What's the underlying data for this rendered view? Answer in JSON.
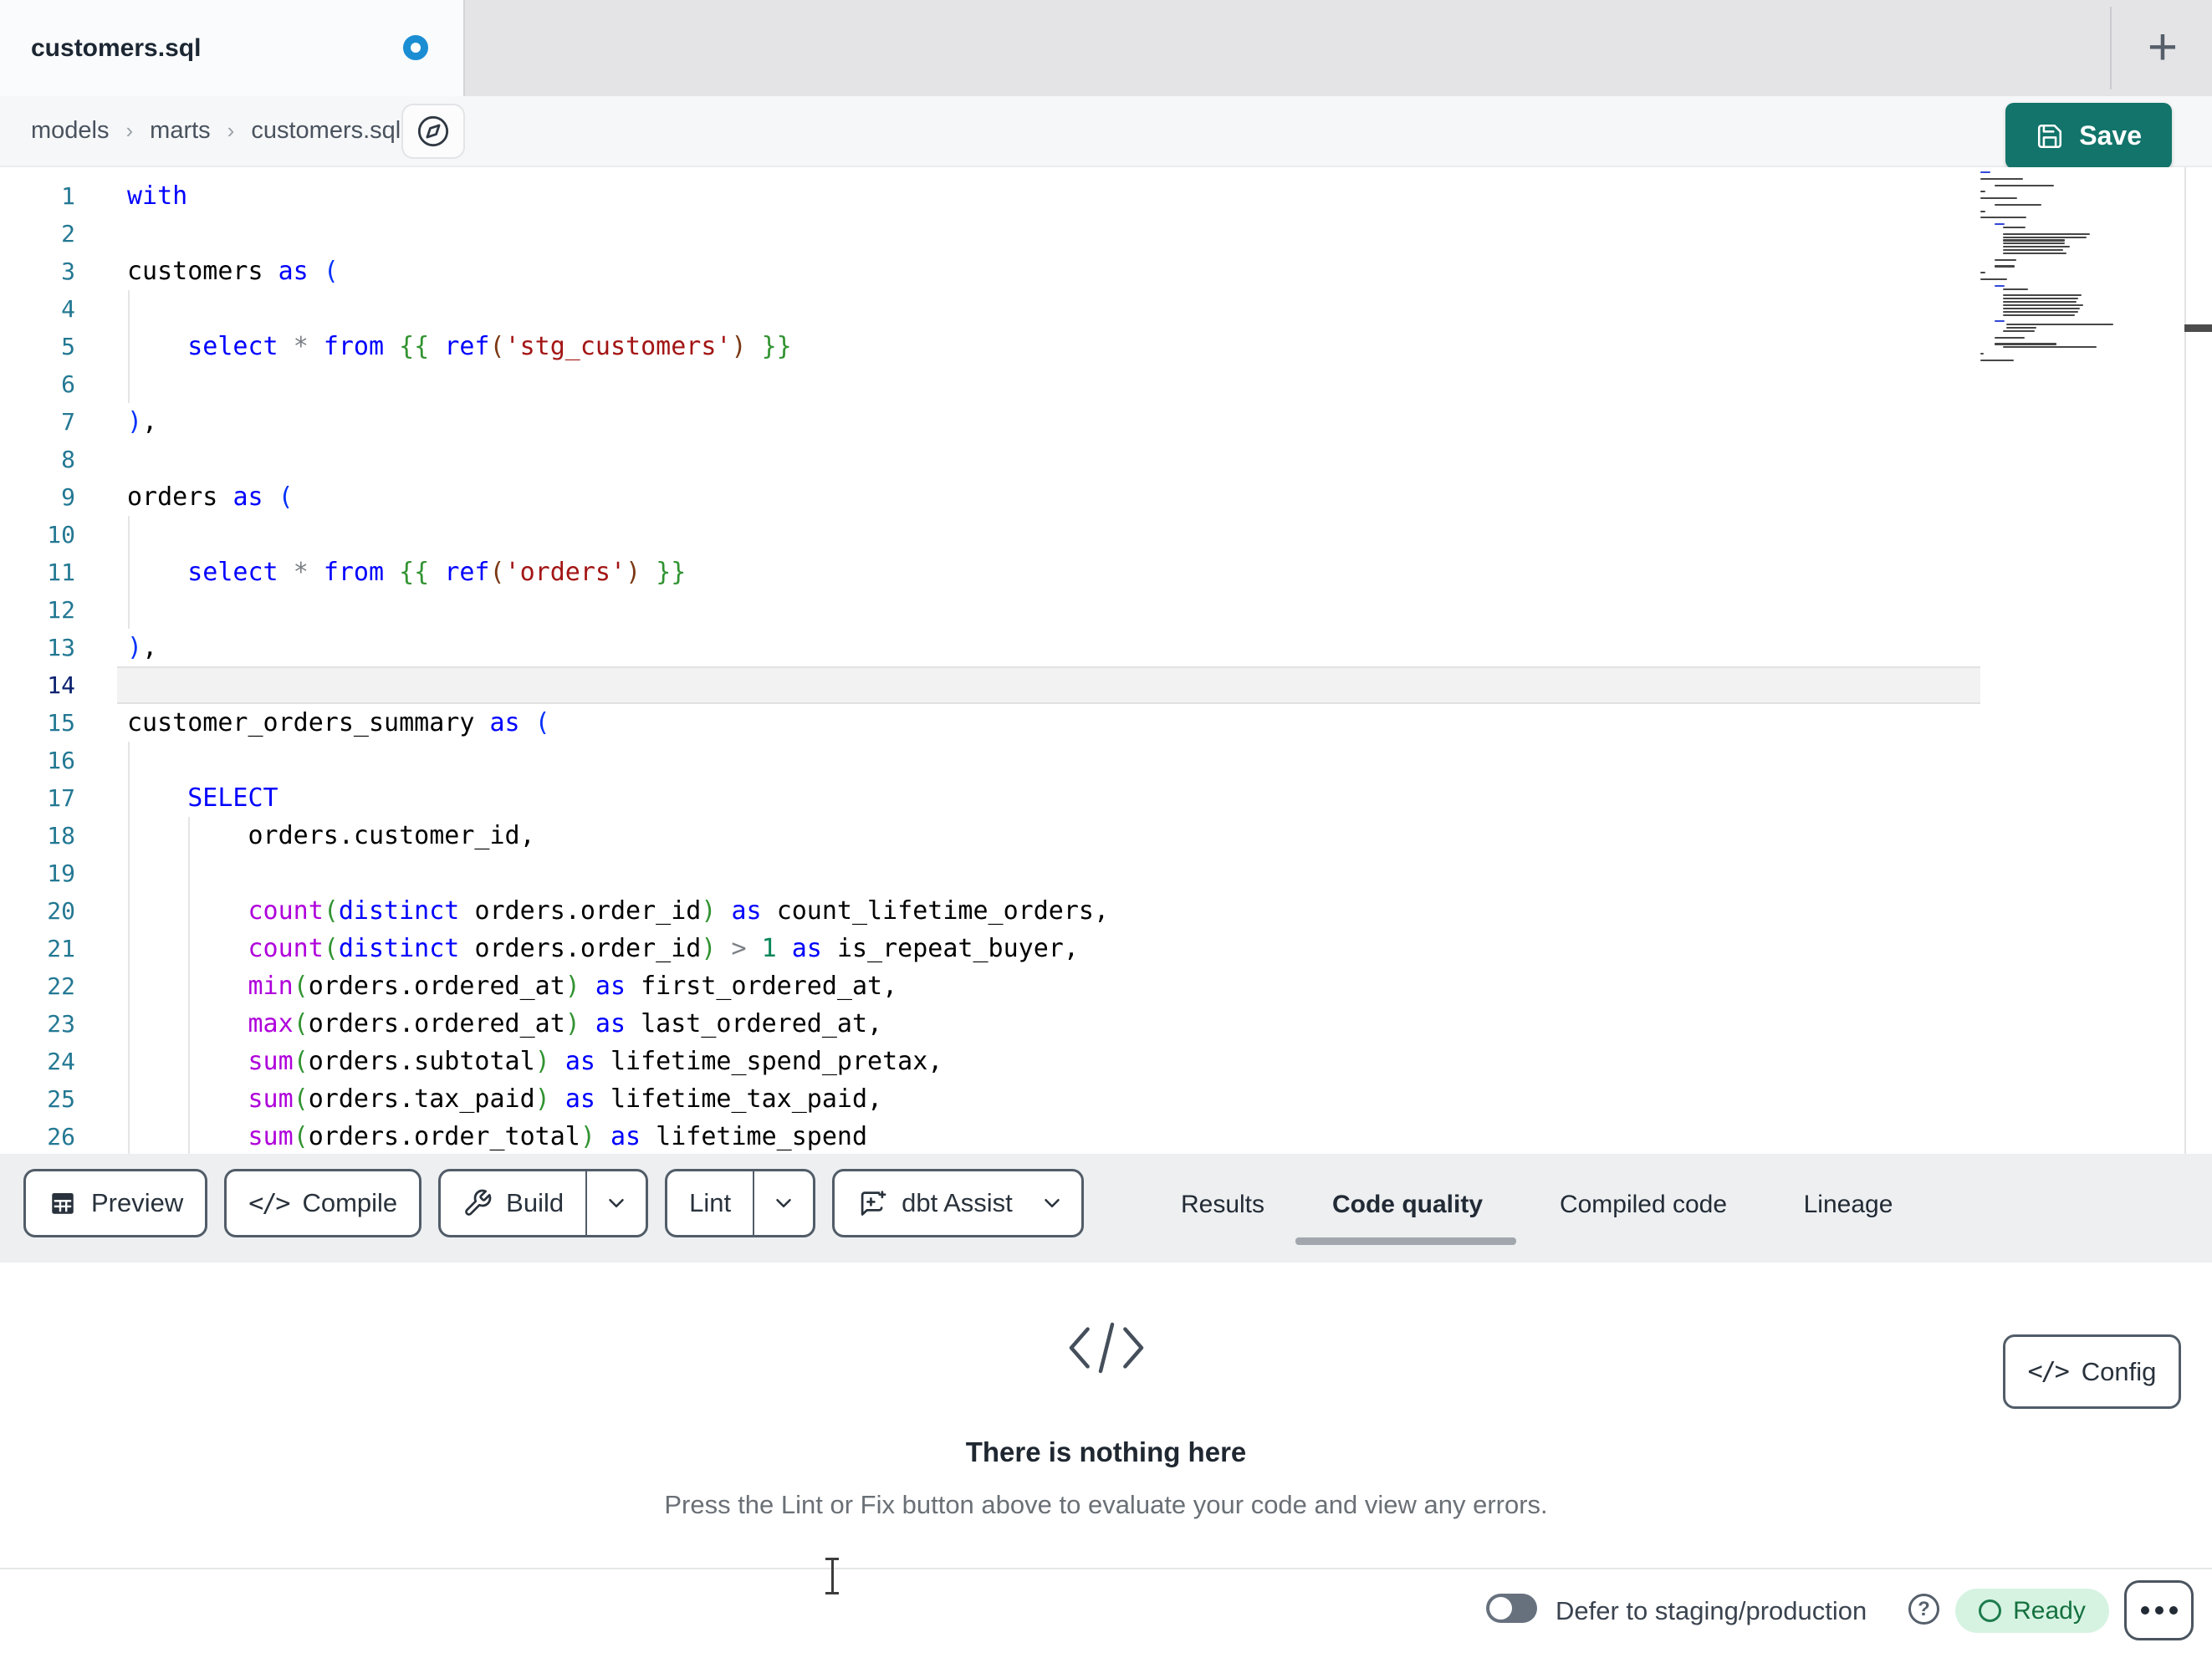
{
  "tab_bar": {
    "active_tab": "customers.sql",
    "unsaved_indicator": true,
    "new_tab_label": "+"
  },
  "breadcrumb": {
    "items": [
      "models",
      "marts",
      "customers.sql"
    ],
    "separator": "›"
  },
  "actions": {
    "save_label": "Save"
  },
  "editor": {
    "current_line": 14,
    "lines": [
      {
        "n": 1,
        "t": [
          [
            "kw",
            "with"
          ]
        ]
      },
      {
        "n": 2,
        "t": []
      },
      {
        "n": 3,
        "t": [
          [
            "id",
            "customers "
          ],
          [
            "kw",
            "as"
          ],
          [
            "txt",
            " "
          ],
          [
            "b1",
            "("
          ]
        ]
      },
      {
        "n": 4,
        "t": []
      },
      {
        "n": 5,
        "t": [
          [
            "txt",
            "    "
          ],
          [
            "kw",
            "select"
          ],
          [
            "txt",
            " "
          ],
          [
            "op",
            "*"
          ],
          [
            "txt",
            " "
          ],
          [
            "kw",
            "from"
          ],
          [
            "txt",
            " "
          ],
          [
            "b2",
            "{{"
          ],
          [
            "txt",
            " "
          ],
          [
            "kw",
            "ref"
          ],
          [
            "b3",
            "("
          ],
          [
            "str",
            "'stg_customers'"
          ],
          [
            "b3",
            ")"
          ],
          [
            "txt",
            " "
          ],
          [
            "b2",
            "}}"
          ]
        ]
      },
      {
        "n": 6,
        "t": []
      },
      {
        "n": 7,
        "t": [
          [
            "b1",
            ")"
          ],
          [
            "id",
            ","
          ]
        ]
      },
      {
        "n": 8,
        "t": []
      },
      {
        "n": 9,
        "t": [
          [
            "id",
            "orders "
          ],
          [
            "kw",
            "as"
          ],
          [
            "txt",
            " "
          ],
          [
            "b1",
            "("
          ]
        ]
      },
      {
        "n": 10,
        "t": []
      },
      {
        "n": 11,
        "t": [
          [
            "txt",
            "    "
          ],
          [
            "kw",
            "select"
          ],
          [
            "txt",
            " "
          ],
          [
            "op",
            "*"
          ],
          [
            "txt",
            " "
          ],
          [
            "kw",
            "from"
          ],
          [
            "txt",
            " "
          ],
          [
            "b2",
            "{{"
          ],
          [
            "txt",
            " "
          ],
          [
            "kw",
            "ref"
          ],
          [
            "b3",
            "("
          ],
          [
            "str",
            "'orders'"
          ],
          [
            "b3",
            ")"
          ],
          [
            "txt",
            " "
          ],
          [
            "b2",
            "}}"
          ]
        ]
      },
      {
        "n": 12,
        "t": []
      },
      {
        "n": 13,
        "t": [
          [
            "b1",
            ")"
          ],
          [
            "id",
            ","
          ]
        ]
      },
      {
        "n": 14,
        "t": []
      },
      {
        "n": 15,
        "t": [
          [
            "id",
            "customer_orders_summary "
          ],
          [
            "kw",
            "as"
          ],
          [
            "txt",
            " "
          ],
          [
            "b1",
            "("
          ]
        ]
      },
      {
        "n": 16,
        "t": []
      },
      {
        "n": 17,
        "t": [
          [
            "txt",
            "    "
          ],
          [
            "kw",
            "SELECT"
          ]
        ]
      },
      {
        "n": 18,
        "t": [
          [
            "txt",
            "        "
          ],
          [
            "id",
            "orders.customer_id,"
          ]
        ]
      },
      {
        "n": 19,
        "t": []
      },
      {
        "n": 20,
        "t": [
          [
            "txt",
            "        "
          ],
          [
            "fn",
            "count"
          ],
          [
            "b2",
            "("
          ],
          [
            "kw",
            "distinct"
          ],
          [
            "txt",
            " "
          ],
          [
            "id",
            "orders.order_id"
          ],
          [
            "b2",
            ")"
          ],
          [
            "txt",
            " "
          ],
          [
            "kw",
            "as"
          ],
          [
            "txt",
            " "
          ],
          [
            "id",
            "count_lifetime_orders,"
          ]
        ]
      },
      {
        "n": 21,
        "t": [
          [
            "txt",
            "        "
          ],
          [
            "fn",
            "count"
          ],
          [
            "b2",
            "("
          ],
          [
            "kw",
            "distinct"
          ],
          [
            "txt",
            " "
          ],
          [
            "id",
            "orders.order_id"
          ],
          [
            "b2",
            ")"
          ],
          [
            "txt",
            " "
          ],
          [
            "op",
            ">"
          ],
          [
            "txt",
            " "
          ],
          [
            "num",
            "1"
          ],
          [
            "txt",
            " "
          ],
          [
            "kw",
            "as"
          ],
          [
            "txt",
            " "
          ],
          [
            "id",
            "is_repeat_buyer,"
          ]
        ]
      },
      {
        "n": 22,
        "t": [
          [
            "txt",
            "        "
          ],
          [
            "fn",
            "min"
          ],
          [
            "b2",
            "("
          ],
          [
            "id",
            "orders.ordered_at"
          ],
          [
            "b2",
            ")"
          ],
          [
            "txt",
            " "
          ],
          [
            "kw",
            "as"
          ],
          [
            "txt",
            " "
          ],
          [
            "id",
            "first_ordered_at,"
          ]
        ]
      },
      {
        "n": 23,
        "t": [
          [
            "txt",
            "        "
          ],
          [
            "fn",
            "max"
          ],
          [
            "b2",
            "("
          ],
          [
            "id",
            "orders.ordered_at"
          ],
          [
            "b2",
            ")"
          ],
          [
            "txt",
            " "
          ],
          [
            "kw",
            "as"
          ],
          [
            "txt",
            " "
          ],
          [
            "id",
            "last_ordered_at,"
          ]
        ]
      },
      {
        "n": 24,
        "t": [
          [
            "txt",
            "        "
          ],
          [
            "fn",
            "sum"
          ],
          [
            "b2",
            "("
          ],
          [
            "id",
            "orders.subtotal"
          ],
          [
            "b2",
            ")"
          ],
          [
            "txt",
            " "
          ],
          [
            "kw",
            "as"
          ],
          [
            "txt",
            " "
          ],
          [
            "id",
            "lifetime_spend_pretax,"
          ]
        ]
      },
      {
        "n": 25,
        "t": [
          [
            "txt",
            "        "
          ],
          [
            "fn",
            "sum"
          ],
          [
            "b2",
            "("
          ],
          [
            "id",
            "orders.tax_paid"
          ],
          [
            "b2",
            ")"
          ],
          [
            "txt",
            " "
          ],
          [
            "kw",
            "as"
          ],
          [
            "txt",
            " "
          ],
          [
            "id",
            "lifetime_tax_paid,"
          ]
        ]
      },
      {
        "n": 26,
        "t": [
          [
            "txt",
            "        "
          ],
          [
            "fn",
            "sum"
          ],
          [
            "b2",
            "("
          ],
          [
            "id",
            "orders.order_total"
          ],
          [
            "b2",
            ")"
          ],
          [
            "txt",
            " "
          ],
          [
            "kw",
            "as"
          ],
          [
            "txt",
            " "
          ],
          [
            "id",
            "lifetime_spend"
          ]
        ]
      }
    ]
  },
  "minimap": {
    "rows": [
      {
        "x": 0,
        "w": 12,
        "c": "#3148d8"
      },
      {
        "x": 0,
        "w": 0,
        "c": "transparent"
      },
      {
        "x": 0,
        "w": 51,
        "c": "#464646"
      },
      {
        "x": 0,
        "w": 0,
        "c": "transparent"
      },
      {
        "x": 17,
        "w": 71,
        "c": "#464646"
      },
      {
        "x": 0,
        "w": 0,
        "c": "transparent"
      },
      {
        "x": 0,
        "w": 6,
        "c": "#464646"
      },
      {
        "x": 0,
        "w": 0,
        "c": "transparent"
      },
      {
        "x": 0,
        "w": 44,
        "c": "#464646"
      },
      {
        "x": 0,
        "w": 0,
        "c": "transparent"
      },
      {
        "x": 17,
        "w": 56,
        "c": "#464646"
      },
      {
        "x": 0,
        "w": 0,
        "c": "transparent"
      },
      {
        "x": 0,
        "w": 6,
        "c": "#464646"
      },
      {
        "x": 0,
        "w": 0,
        "c": "transparent"
      },
      {
        "x": 0,
        "w": 55,
        "c": "#464646"
      },
      {
        "x": 0,
        "w": 0,
        "c": "transparent"
      },
      {
        "x": 17,
        "w": 12,
        "c": "#3148d8"
      },
      {
        "x": 27,
        "w": 27,
        "c": "#464646"
      },
      {
        "x": 0,
        "w": 0,
        "c": "transparent"
      },
      {
        "x": 27,
        "w": 104,
        "c": "#464646"
      },
      {
        "x": 27,
        "w": 100,
        "c": "#464646"
      },
      {
        "x": 27,
        "w": 74,
        "c": "#464646"
      },
      {
        "x": 27,
        "w": 74,
        "c": "#464646"
      },
      {
        "x": 27,
        "w": 80,
        "c": "#464646"
      },
      {
        "x": 27,
        "w": 72,
        "c": "#464646"
      },
      {
        "x": 27,
        "w": 76,
        "c": "#464646"
      },
      {
        "x": 0,
        "w": 0,
        "c": "transparent"
      },
      {
        "x": 17,
        "w": 26,
        "c": "#464646"
      },
      {
        "x": 0,
        "w": 0,
        "c": "transparent"
      },
      {
        "x": 17,
        "w": 24,
        "c": "#464646"
      },
      {
        "x": 0,
        "w": 0,
        "c": "transparent"
      },
      {
        "x": 0,
        "w": 6,
        "c": "#464646"
      },
      {
        "x": 0,
        "w": 0,
        "c": "transparent"
      },
      {
        "x": 0,
        "w": 32,
        "c": "#464646"
      },
      {
        "x": 0,
        "w": 0,
        "c": "transparent"
      },
      {
        "x": 17,
        "w": 12,
        "c": "#3148d8"
      },
      {
        "x": 27,
        "w": 30,
        "c": "#464646"
      },
      {
        "x": 0,
        "w": 0,
        "c": "transparent"
      },
      {
        "x": 27,
        "w": 94,
        "c": "#464646"
      },
      {
        "x": 27,
        "w": 90,
        "c": "#464646"
      },
      {
        "x": 27,
        "w": 88,
        "c": "#464646"
      },
      {
        "x": 27,
        "w": 96,
        "c": "#464646"
      },
      {
        "x": 27,
        "w": 92,
        "c": "#464646"
      },
      {
        "x": 27,
        "w": 90,
        "c": "#464646"
      },
      {
        "x": 27,
        "w": 86,
        "c": "#464646"
      },
      {
        "x": 0,
        "w": 0,
        "c": "transparent"
      },
      {
        "x": 17,
        "w": 12,
        "c": "#3148d8"
      },
      {
        "x": 31,
        "w": 128,
        "c": "#464646"
      },
      {
        "x": 31,
        "w": 36,
        "c": "#464646"
      },
      {
        "x": 27,
        "w": 38,
        "c": "#464646"
      },
      {
        "x": 0,
        "w": 0,
        "c": "transparent"
      },
      {
        "x": 17,
        "w": 36,
        "c": "#464646"
      },
      {
        "x": 0,
        "w": 0,
        "c": "transparent"
      },
      {
        "x": 17,
        "w": 74,
        "c": "#464646"
      },
      {
        "x": 27,
        "w": 112,
        "c": "#464646"
      },
      {
        "x": 0,
        "w": 0,
        "c": "transparent"
      },
      {
        "x": 0,
        "w": 4,
        "c": "#464646"
      },
      {
        "x": 0,
        "w": 0,
        "c": "transparent"
      },
      {
        "x": 0,
        "w": 40,
        "c": "#464646"
      }
    ]
  },
  "toolbar": {
    "preview_label": "Preview",
    "compile_label": "Compile",
    "build_label": "Build",
    "lint_label": "Lint",
    "assist_label": "dbt Assist",
    "compile_glyph": "</>"
  },
  "panel": {
    "tabs": [
      {
        "label": "Results",
        "active": false
      },
      {
        "label": "Code quality",
        "active": true
      },
      {
        "label": "Compiled code",
        "active": false
      },
      {
        "label": "Lineage",
        "active": false
      }
    ],
    "empty_state": {
      "title": "There is nothing here",
      "subtitle": "Press the Lint or Fix button above to evaluate your code and view any errors."
    },
    "config_label": "Config",
    "config_glyph": "</>"
  },
  "status_bar": {
    "defer_label": "Defer to staging/production",
    "help_glyph": "?",
    "ready_label": "Ready"
  },
  "colors": {
    "save_button": "#12746a",
    "unsaved_dot": "#1b8ed3",
    "ready_badge_bg": "#d6f3e2",
    "ready_badge_text": "#15713f",
    "line_number": "#237893",
    "keyword": "#0000ff",
    "function": "#af00db",
    "string": "#a31515"
  }
}
